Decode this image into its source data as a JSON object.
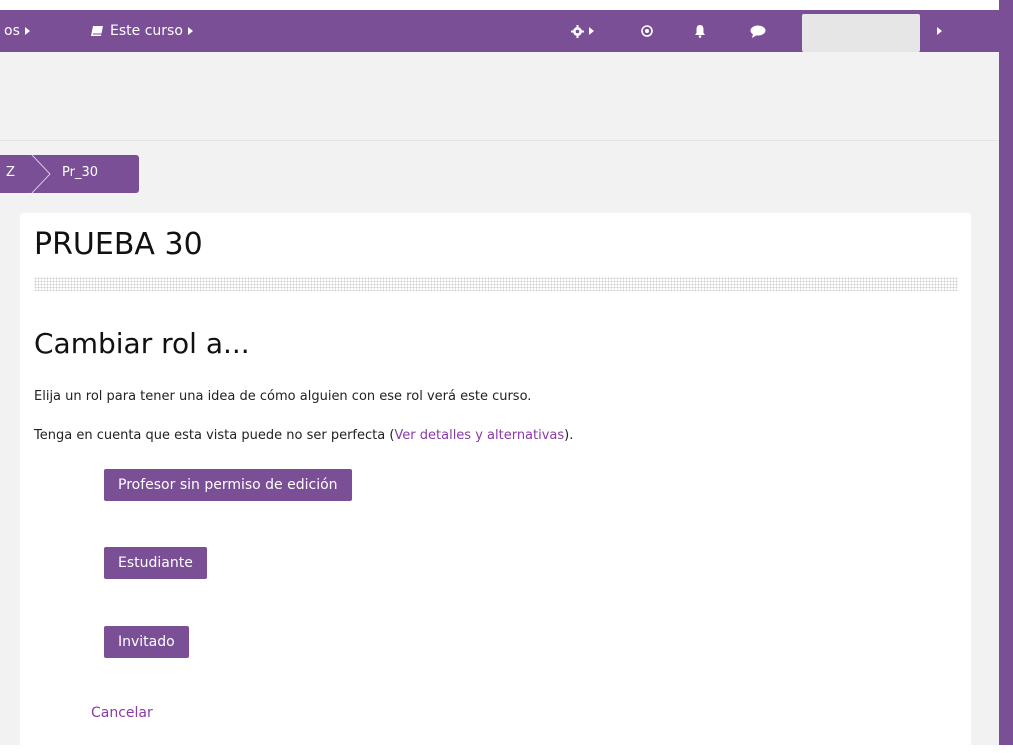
{
  "navbar": {
    "courses_fragment": "os",
    "this_course_label": "Este curso"
  },
  "breadcrumb": {
    "prev_fragment": "Z",
    "current": "Pr_30"
  },
  "course": {
    "title": "PRUEBA 30"
  },
  "switch_role": {
    "heading": "Cambiar rol a...",
    "intro": "Elija un rol para tener una idea de cómo alguien con ese rol verá este curso.",
    "note_before": "Tenga en cuenta que esta vista puede no ser perfecta (",
    "note_link": "Ver detalles y alternativas",
    "note_after": ").",
    "roles": [
      "Profesor sin permiso de edición",
      "Estudiante",
      "Invitado"
    ],
    "cancel": "Cancelar"
  },
  "colors": {
    "brand": "#7a4f96",
    "link": "#8a3aa8",
    "background": "#f2f2f2"
  },
  "icons": [
    "book-icon",
    "gear-icon",
    "target-icon",
    "bell-icon",
    "chat-icon",
    "caret-right-icon"
  ]
}
